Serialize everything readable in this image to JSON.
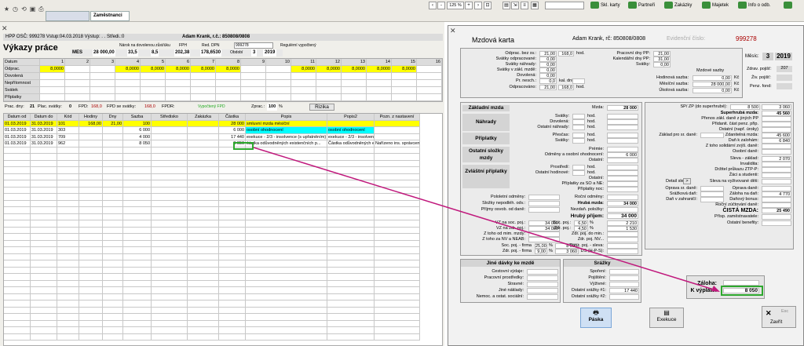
{
  "topbar": {
    "tabs": [
      "",
      "Zaměstnanci"
    ],
    "zoom": "125 %",
    "nav_buttons": [
      "Skl. karty",
      "Partneři",
      "Zakázky",
      "Majetek",
      "Info o odb."
    ]
  },
  "left": {
    "info_bar": "HPP  OSČ: 999278  Vstup:04.03.2018  Výstup: . .   Středi.:0",
    "info_name": "Adam  Krank, r.č.: 850808/0808",
    "title": "Výkazy práce",
    "nastaveni_label": "Nárok na dovolenou zůst/úku",
    "fph_label": "FPH",
    "red_dpn_label": "Red. DPN",
    "red_dpn_value": "999278",
    "mes_label": "MES",
    "hdr_values": [
      "28 000,00",
      "33,5",
      "8,5",
      "202,38",
      "178,6530"
    ],
    "period_label": "Období",
    "period_month": "3",
    "period_year": "2019",
    "reg_label": "Regulérní vypočtený",
    "cal_row_labels": [
      "Datum",
      "Odprac.",
      "Dovolená",
      "Nepřítomnost",
      "Svátek",
      "Příplatky"
    ],
    "days": [
      "1",
      "2",
      "3",
      "4",
      "5",
      "6",
      "7",
      "8",
      "9",
      "10",
      "11",
      "12",
      "13",
      "14",
      "15",
      "16"
    ],
    "odprac": [
      "8,0000",
      "",
      "",
      "8,0000",
      "8,0000",
      "8,0000",
      "8,0000",
      "8,0000",
      "",
      "",
      "8,0000",
      "8,0000",
      "8,0000",
      "8,0000",
      "8,0000",
      ""
    ],
    "sum_bar": {
      "prac_dny_label": "Prac. dny:",
      "prac_dny": "21",
      "plac_svatky_label": "Plac. svátky:",
      "plac_svatky": "0",
      "fpd_label": "FPD:",
      "fpd": "168,0",
      "fpd_svatky_label": "FPD se svátky:",
      "fpd_svatky": "168,0",
      "fpdr_label": "FPDR:",
      "vyp_label": "Vypočtený FPD",
      "zprac_label": "Zprac.:",
      "zprac": "100",
      "rizika": "Rizika"
    },
    "grid_headers": [
      "Datum od",
      "Datum do",
      "Kód",
      "Hodiny",
      "Dny",
      "Sazba",
      "Středisko",
      "Zakázka",
      "Částka",
      "Popis",
      "Popis2",
      "Pozn. z nastavení"
    ],
    "grid_rows": [
      [
        "01.03.2019",
        "31.03.2019",
        "101",
        "168,00",
        "21,00",
        "100",
        "",
        "",
        "28 000",
        "smluvní mzda měsíční",
        "",
        ""
      ],
      [
        "01.03.2019",
        "31.03.2019",
        "303",
        "",
        "",
        "6 000",
        "",
        "",
        "6 000",
        "osobní ohodnocení",
        "osobní ohodnocení",
        ""
      ],
      [
        "01.03.2019",
        "31.03.2019",
        "709",
        "",
        "",
        "4 000",
        "",
        "",
        "17 440",
        "exekuce - 2/3 - insolvence (s upřatněním)",
        "exekuce - 2/3 - insolvence",
        ""
      ],
      [
        "01.03.2019",
        "31.03.2019",
        "962",
        "",
        "",
        "8 050",
        "",
        "",
        "8 050",
        "částka odůvodněných existenčních p...",
        "Částka odůvodněných e...",
        "Nařízeno ins. správcem"
      ]
    ]
  },
  "dialog": {
    "title": "Mzdová karta",
    "employee": "Adam  Krank, rč: 850808/0808",
    "evid_label": "Evidenční číslo:",
    "evid_no": "999278",
    "mesic_label": "Měsíc:",
    "mesic": "3",
    "rok": "2019",
    "top": {
      "odprac_bez_sv_label": "Odprac. bez sv.:",
      "odprac_bez_sv": "21,00",
      "odprac_bez_sv_h": "168,0",
      "hod": "hod.",
      "svatky_odprac_label": "Svátky odpracované:",
      "svatky_odprac": "0,00",
      "svatky_nahrady_label": "Svátky náhrady:",
      "svatky_nahrady": "0,00",
      "svatky_zakl_label": "Svátky v zákl. mzdě:",
      "svatky_zakl": "0,00",
      "dovolena_label": "Dovolená:",
      "dovolena": "0,00",
      "pr_nesch_label": "Pr. nesch.:",
      "pr_nesch": "0,0",
      "kal_dni": "kal. dní",
      "odpracovano_label": "Odpracováno:",
      "odpracovano": "21,00",
      "odpracovano_h": "168,0",
      "prac_dny_pp_label": "Pracovní dny PP:",
      "prac_dny_pp": "21,00",
      "kal_dny_pp_label": "Kalendářní dny PP:",
      "kal_dny_pp": "31,00",
      "svatky_label": "Svátky:",
      "svatky": "0,00",
      "mzdove_sazby": "Mzdové sazby",
      "hod_sazba_label": "Hodinová sazba:",
      "hod_sazba": "0,00",
      "mes_sazba_label": "Měsíční sazba:",
      "mes_sazba": "28 000,00",
      "ukol_sazba_label": "Úkolová sazba:",
      "ukol_sazba": "0,00",
      "kc": "Kč",
      "zdrav_label": "Zdrav. pojišť:",
      "zdrav": "207",
      "ziv_label": "Živ. pojišť:",
      "penz_label": "Penz. fond:"
    },
    "mid": {
      "zakladni_mzda": "Základní mzda",
      "mzda_label": "Mzda:",
      "mzda": "28 000",
      "nahrady": "Náhrady",
      "svatky_label": "Svátky:",
      "dovolena_label": "Dovolená:",
      "ostatni_nahrady_label": "Ostatní náhrady:",
      "priplatky": "Příplatky",
      "prescas_label": "Přesčas:",
      "svatky2_label": "Svátky:",
      "ostatni_slozky": "Ostatní složky mzdy",
      "premie_label": "Prémie:",
      "odmeny_label": "Odměny a osobní ohodnocení:",
      "odmeny": "6 000",
      "ostatni_label": "Ostatní:",
      "zvlastni_priplatky": "Zvláštní příplatky",
      "prostredi_label": "Prostředí:",
      "ostatni_hod_label": "Ostatní hodinové:",
      "ostatni2_label": "Ostatní:",
      "priplatky_so_label": "Příplatky za SO a NE:",
      "priplatky_nv_label": "Příplatky noc:",
      "hod": "hod."
    },
    "right": {
      "sp_zp_label": "SP/ ZP (do superhrubé):",
      "sp": "8 500",
      "zp": "3 060",
      "superhruba_label": "Superhrubá mzda:",
      "superhruba": "45 560",
      "prevod_label": "Přenos zákl. daně z jiných PP",
      "prid_label": "Přidanit. část penz. přip.",
      "ostatni_label": "Ostatní (např. úroky)",
      "zaklad_label": "Základ pro sr. daně:",
      "zaklad_mz_label": "Zdanitelná mzda:",
      "zaklad": "45 600",
      "dan_zalohy_label": "Daň k zalohám:",
      "dan_zalohy": "6 840",
      "solid_label": "Z toho solidární zvýš. daně:",
      "osob_dane_label": "Osobní daně:",
      "sleva_zakl_label": "Sleva - základ:",
      "sleva_zakl": "2 070",
      "invalidita_label": "Invalidita:",
      "drzitel_label": "Držitel průkazu ZTP-P:",
      "zaci_label": "Žáci a studenti:",
      "detail_label": "Detail slevy:",
      "sleva_vyz_label": "Sleva na vyživované děti:",
      "oprava_dane_label": "Oprava sr. daně:",
      "srazkova_dan_label": "Srážková daň:",
      "dan_jiz_label": "Daň v zahraničí:",
      "oprava_dane2_label": "Oprava daně:",
      "zaloha_dan_label": "Záloha na daň:",
      "zaloha_dan": "4 770",
      "danovy_bonus_label": "Daňový bonus:",
      "rocni_label": "Roční zúčtování daně:",
      "cista_label": "ČISTÁ MZDA:",
      "cista": "25 490",
      "prisp_zam_label": "Přísp. zaměstnavatele:",
      "ostatni_benefity_label": "Ostatní benefity:"
    },
    "lower": {
      "pololetni_label": "Pololetní odměny:",
      "rocni_odm_label": "Roční odměny:",
      "slozky_label": "Složky nepodléh. odv.:",
      "hruba_label": "Hrubá mzda:",
      "hruba": "34 000",
      "prijmy_label": "Příjmy osvob. od daně:",
      "nezdan_label": "Nezdaň. položky:",
      "hruby_prijem_label": "Hrubý příjem:",
      "hruby_prijem": "34 000",
      "vz_soc_label": "VZ na soc. poj.:",
      "vz_soc": "34 000",
      "vz_zdr_label": "VZ na zdr. poj.:",
      "vz_zdr": "34 000",
      "soc_poj_label": "Soc. poj.:",
      "soc_pct": "6,50",
      "soc": "2 210",
      "zdr_poj_label": "Zdr. poj.:",
      "zdr_pct": "4,50",
      "zdr": "1 530",
      "mim_label": "Z toho od mim. mzdy:",
      "nv_label": "Z toho za NV a NEAB:",
      "zdr_min_label": "Zdr. poj. do min.:",
      "zdr_nv_label": "Zdr. poj. NV...",
      "soc_firma_label": "Soc. poj. - firma",
      "soc_firma_pct": "25,00",
      "soc_firma": "8 500",
      "zdr_firma_label": "Zdr. poj. - firma",
      "zdr_firma_pct": "9,00",
      "zdr_firma": "3 060",
      "penz_sleva_label": "Penz. poj. - sleva:",
      "ds_label": "DS (H-P-S):",
      "pct": "%"
    },
    "bottom": {
      "jine_title": "Jiné dávky ke mzdě",
      "cestovni_label": "Cestovní výdaje:",
      "pracovni_label": "Pracovní prostředky:",
      "stravne_label": "Stravné:",
      "jine_label": "Jiné náklady:",
      "nemoc_label": "Nemoc. a ostat. sociální:",
      "srazky_title": "Srážky",
      "sporeni_label": "Spoření:",
      "pojisteni_label": "Pojištění:",
      "vyzivne_label": "Výživné:",
      "ostatni1_label": "Ostatní srážky #1:",
      "ostatni1": "17 440",
      "ostatni2_label": "Ostatní srážky #2:",
      "zaloha_label": "Záloha:",
      "k_vyplate_label": "K výplatě:",
      "k_vyplate": "8 050"
    },
    "buttons": {
      "paska": "Páska",
      "exekuce": "Exekuce",
      "esc": "Esc",
      "zavrit": "Zavřít"
    }
  },
  "colors": {
    "highlight_green": "#2ea82e",
    "arrow": "#c0187c",
    "yellow_row": "#ffff00",
    "cyan_row": "#00ffff",
    "title_red": "#a00000"
  }
}
